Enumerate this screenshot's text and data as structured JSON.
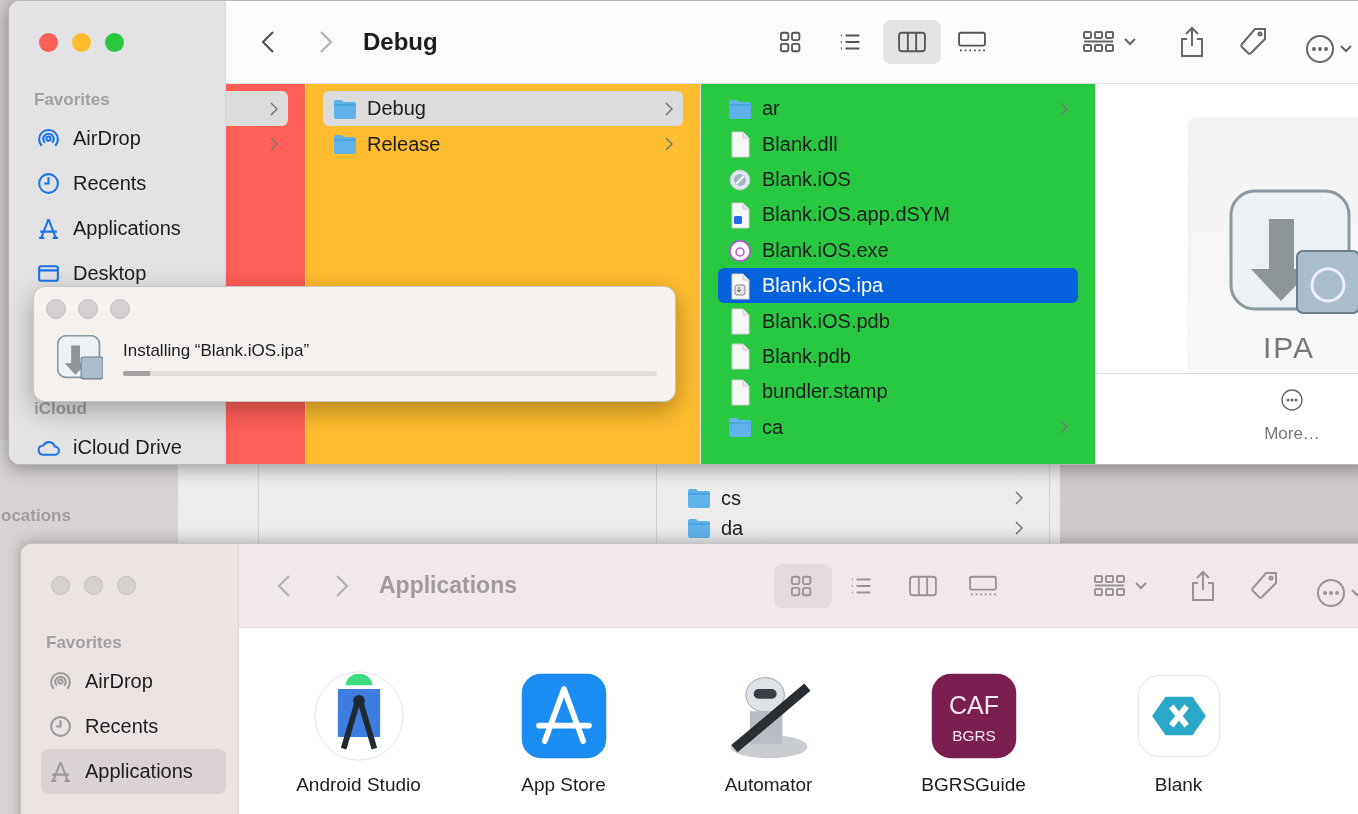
{
  "back_window": {
    "sidebar_heading": "ocations",
    "rows": [
      {
        "name": "cs",
        "kind": "folder"
      },
      {
        "name": "da",
        "kind": "folder"
      }
    ]
  },
  "finder_window": {
    "active": true,
    "title": "Debug",
    "view_modes": [
      {
        "kind": "icons",
        "selected": false
      },
      {
        "kind": "list",
        "selected": false
      },
      {
        "kind": "columns",
        "selected": true
      },
      {
        "kind": "gallery",
        "selected": false
      }
    ],
    "sidebar": [
      {
        "heading": "Favorites",
        "items": [
          {
            "label": "AirDrop",
            "kind": "airdrop",
            "selected": false
          },
          {
            "label": "Recents",
            "kind": "recents",
            "selected": false
          },
          {
            "label": "Applications",
            "kind": "applications",
            "selected": false
          },
          {
            "label": "Desktop",
            "kind": "desktop",
            "selected": false
          }
        ]
      },
      {
        "heading": "iCloud",
        "items": [
          {
            "label": "iCloud Drive",
            "kind": "icloud",
            "selected": false
          }
        ]
      }
    ],
    "column_1": [
      {
        "selected": true
      },
      {
        "selected": false
      }
    ],
    "column_2": [
      {
        "name": "Debug",
        "kind": "folder",
        "selected": true
      },
      {
        "name": "Release",
        "kind": "folder",
        "selected": false
      }
    ],
    "column_3": [
      {
        "name": "ar",
        "kind": "folder",
        "selected": false
      },
      {
        "name": "Blank.dll",
        "kind": "document",
        "selected": false
      },
      {
        "name": "Blank.iOS",
        "kind": "app",
        "selected": false
      },
      {
        "name": "Blank.iOS.app.dSYM",
        "kind": "dsym",
        "selected": false
      },
      {
        "name": "Blank.iOS.exe",
        "kind": "exe",
        "selected": false
      },
      {
        "name": "Blank.iOS.ipa",
        "kind": "ipa",
        "selected": true
      },
      {
        "name": "Blank.iOS.pdb",
        "kind": "document",
        "selected": false
      },
      {
        "name": "Blank.pdb",
        "kind": "document",
        "selected": false
      },
      {
        "name": "bundler.stamp",
        "kind": "document",
        "selected": false
      },
      {
        "name": "ca",
        "kind": "folder",
        "selected": false
      }
    ],
    "preview": {
      "file_type": "IPA",
      "more_label": "More…"
    }
  },
  "installer_dialog": {
    "message": "Installing “Blank.iOS.ipa”",
    "level": 0.05
  },
  "applications_window": {
    "active": false,
    "title": "Applications",
    "view_modes": [
      {
        "kind": "icons",
        "selected": true
      },
      {
        "kind": "list",
        "selected": false
      },
      {
        "kind": "columns",
        "selected": false
      },
      {
        "kind": "gallery",
        "selected": false
      }
    ],
    "sidebar": [
      {
        "heading": "Favorites",
        "items": [
          {
            "label": "AirDrop",
            "kind": "airdrop",
            "selected": false
          },
          {
            "label": "Recents",
            "kind": "recents",
            "selected": false
          },
          {
            "label": "Applications",
            "kind": "applications",
            "selected": true
          }
        ]
      }
    ],
    "apps": [
      {
        "name": "Android Studio",
        "kind": "android_studio"
      },
      {
        "name": "App Store",
        "kind": "app_store"
      },
      {
        "name": "Automator",
        "kind": "automator"
      },
      {
        "name": "BGRSGuide",
        "kind": "caf",
        "icon_text": [
          "CAF",
          "BGRS"
        ]
      },
      {
        "name": "Blank",
        "kind": "xamarin"
      }
    ]
  }
}
